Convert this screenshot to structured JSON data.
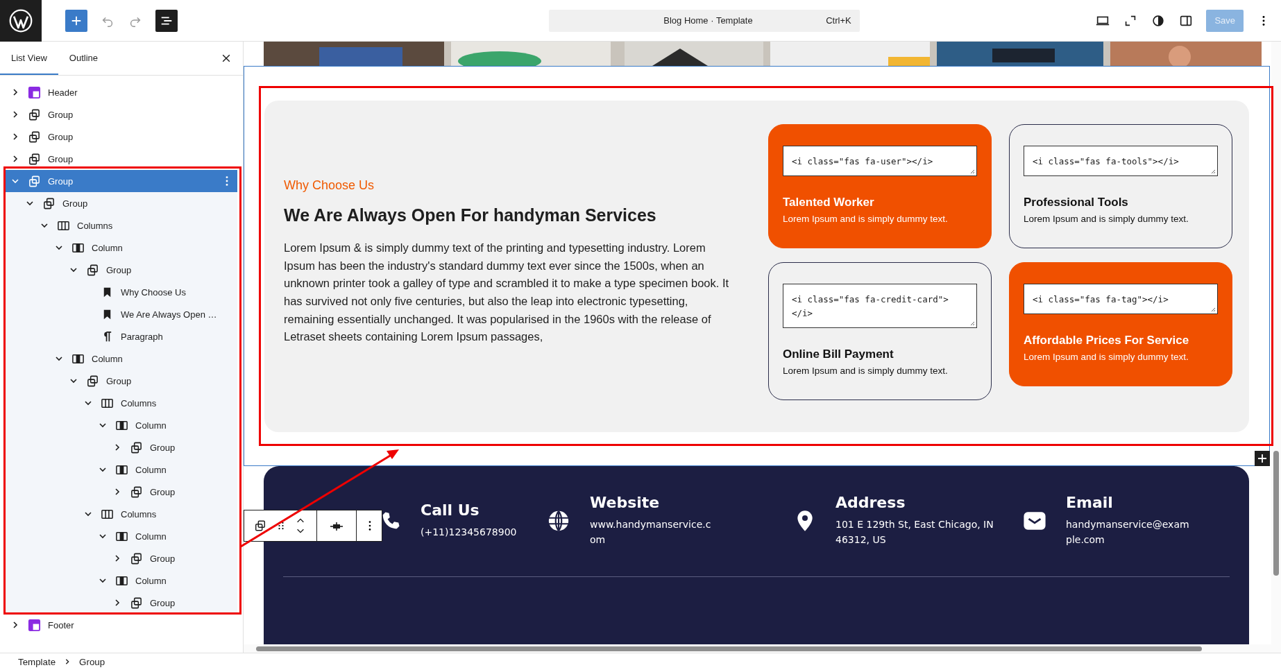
{
  "toolbar": {
    "title": "Blog Home · Template",
    "shortcut": "Ctrl+K",
    "save": "Save",
    "save_disabled": true,
    "list_view_on": true
  },
  "sidebar": {
    "tabs": [
      {
        "label": "List View",
        "selected": true
      },
      {
        "label": "Outline",
        "selected": false
      }
    ],
    "tree": [
      {
        "label": "Header",
        "kind": "template-part",
        "expanded": false,
        "selected": false
      },
      {
        "label": "Group",
        "kind": "group",
        "expanded": false,
        "selected": false
      },
      {
        "label": "Group",
        "kind": "group",
        "expanded": false,
        "selected": false
      },
      {
        "label": "Group",
        "kind": "group",
        "expanded": false,
        "selected": false
      },
      {
        "label": "Group",
        "kind": "group",
        "expanded": true,
        "selected": true,
        "children": [
          {
            "label": "Group",
            "kind": "group",
            "expanded": true,
            "selected": false,
            "children": [
              {
                "label": "Columns",
                "kind": "columns",
                "expanded": true,
                "selected": false,
                "children": [
                  {
                    "label": "Column",
                    "kind": "column",
                    "expanded": true,
                    "selected": false,
                    "children": [
                      {
                        "label": "Group",
                        "kind": "group",
                        "expanded": true,
                        "selected": false,
                        "children": [
                          {
                            "label": "Why Choose Us",
                            "kind": "heading",
                            "selected": false
                          },
                          {
                            "label": "We Are Always Open …",
                            "kind": "heading",
                            "selected": false
                          },
                          {
                            "label": "Paragraph",
                            "kind": "paragraph",
                            "selected": false
                          }
                        ]
                      }
                    ]
                  },
                  {
                    "label": "Column",
                    "kind": "column",
                    "expanded": true,
                    "selected": false,
                    "children": [
                      {
                        "label": "Group",
                        "kind": "group",
                        "expanded": true,
                        "selected": false,
                        "children": [
                          {
                            "label": "Columns",
                            "kind": "columns",
                            "expanded": true,
                            "selected": false,
                            "children": [
                              {
                                "label": "Column",
                                "kind": "column",
                                "expanded": true,
                                "selected": false,
                                "children": [
                                  {
                                    "label": "Group",
                                    "kind": "group",
                                    "expanded": false,
                                    "selected": false
                                  }
                                ]
                              },
                              {
                                "label": "Column",
                                "kind": "column",
                                "expanded": true,
                                "selected": false,
                                "children": [
                                  {
                                    "label": "Group",
                                    "kind": "group",
                                    "expanded": false,
                                    "selected": false
                                  }
                                ]
                              }
                            ]
                          },
                          {
                            "label": "Columns",
                            "kind": "columns",
                            "expanded": true,
                            "selected": false,
                            "children": [
                              {
                                "label": "Column",
                                "kind": "column",
                                "expanded": true,
                                "selected": false,
                                "children": [
                                  {
                                    "label": "Group",
                                    "kind": "group",
                                    "expanded": false,
                                    "selected": false
                                  }
                                ]
                              },
                              {
                                "label": "Column",
                                "kind": "column",
                                "expanded": true,
                                "selected": false,
                                "children": [
                                  {
                                    "label": "Group",
                                    "kind": "group",
                                    "expanded": false,
                                    "selected": false
                                  }
                                ]
                              }
                            ]
                          }
                        ]
                      }
                    ]
                  }
                ]
              }
            ]
          }
        ]
      },
      {
        "label": "Footer",
        "kind": "template-part",
        "expanded": false,
        "selected": false
      }
    ]
  },
  "canvas": {
    "section": {
      "eyebrow": "Why Choose Us",
      "heading": "We Are Always Open For handyman Services",
      "paragraph": "Lorem Ipsum & is simply dummy text of the printing and typesetting industry. Lorem Ipsum has been the industry's standard dummy text ever since the 1500s, when an unknown printer took a galley of type and scrambled it to make a type specimen book. It has survived not only five centuries, but also the leap into electronic typesetting, remaining essentially unchanged. It was popularised in the 1960s with the release of Letraset sheets containing Lorem Ipsum passages,",
      "cards": [
        {
          "code": "<i class=\"fas fa-user\"></i>",
          "title": "Talented Worker",
          "text": "Lorem Ipsum and is simply dummy text.",
          "highlighted": true
        },
        {
          "code": "<i class=\"fas fa-tools\"></i>",
          "title": "Professional Tools",
          "text": "Lorem Ipsum and is simply dummy text.",
          "highlighted": false
        },
        {
          "code": "<i class=\"fas fa-credit-card\">\n</i>",
          "title": "Online Bill Payment",
          "text": "Lorem Ipsum and is simply dummy text.",
          "highlighted": false
        },
        {
          "code": "<i class=\"fas fa-tag\"></i>",
          "title": "Affordable Prices For Service",
          "text": "Lorem Ipsum and is simply dummy text.",
          "highlighted": true
        }
      ]
    },
    "footer": {
      "contacts": [
        {
          "kind": "phone",
          "title": "Call Us",
          "value": "(+11)12345678900"
        },
        {
          "kind": "globe",
          "title": "Website",
          "value": "www.handymanservice.c\nom"
        },
        {
          "kind": "pin",
          "title": "Address",
          "value": "101 E 129th St, East Chicago, IN\n46312, US"
        },
        {
          "kind": "mail",
          "title": "Email",
          "value": "handymanservice@exam\nple.com"
        }
      ]
    }
  },
  "breadcrumb": [
    "Template",
    "Group"
  ]
}
